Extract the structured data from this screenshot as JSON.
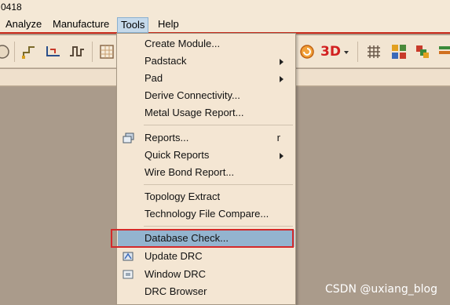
{
  "window": {
    "title_fragment": "0418"
  },
  "menubar": {
    "items": [
      "Analyze",
      "Manufacture",
      "Tools",
      "Help"
    ],
    "active": "Tools"
  },
  "tools_menu": {
    "items": [
      {
        "label": "Create Module...",
        "submenu": false
      },
      {
        "label": "Padstack",
        "submenu": true
      },
      {
        "label": "Pad",
        "submenu": true
      },
      {
        "label": "Derive Connectivity...",
        "submenu": false
      },
      {
        "label": "Metal Usage Report...",
        "submenu": false
      },
      {
        "label": "Reports...",
        "shortcut": "r",
        "icon": "reports-icon"
      },
      {
        "label": "Quick Reports",
        "submenu": true
      },
      {
        "label": "Wire Bond Report...",
        "submenu": false
      },
      {
        "label": "Topology Extract",
        "submenu": false
      },
      {
        "label": "Technology File Compare...",
        "submenu": false
      },
      {
        "label": "Database Check...",
        "highlighted": true
      },
      {
        "label": "Update DRC",
        "icon": "update-drc-icon"
      },
      {
        "label": "Window DRC",
        "icon": "window-drc-icon"
      },
      {
        "label": "DRC Browser",
        "submenu": false
      }
    ]
  },
  "toolbar": {
    "three_d_label": "3D"
  },
  "watermark": "CSDN @uxiang_blog",
  "colors": {
    "highlight": "#93b4cf",
    "annotation_box": "#d42a2a",
    "menubar_underline": "#c8291a"
  }
}
